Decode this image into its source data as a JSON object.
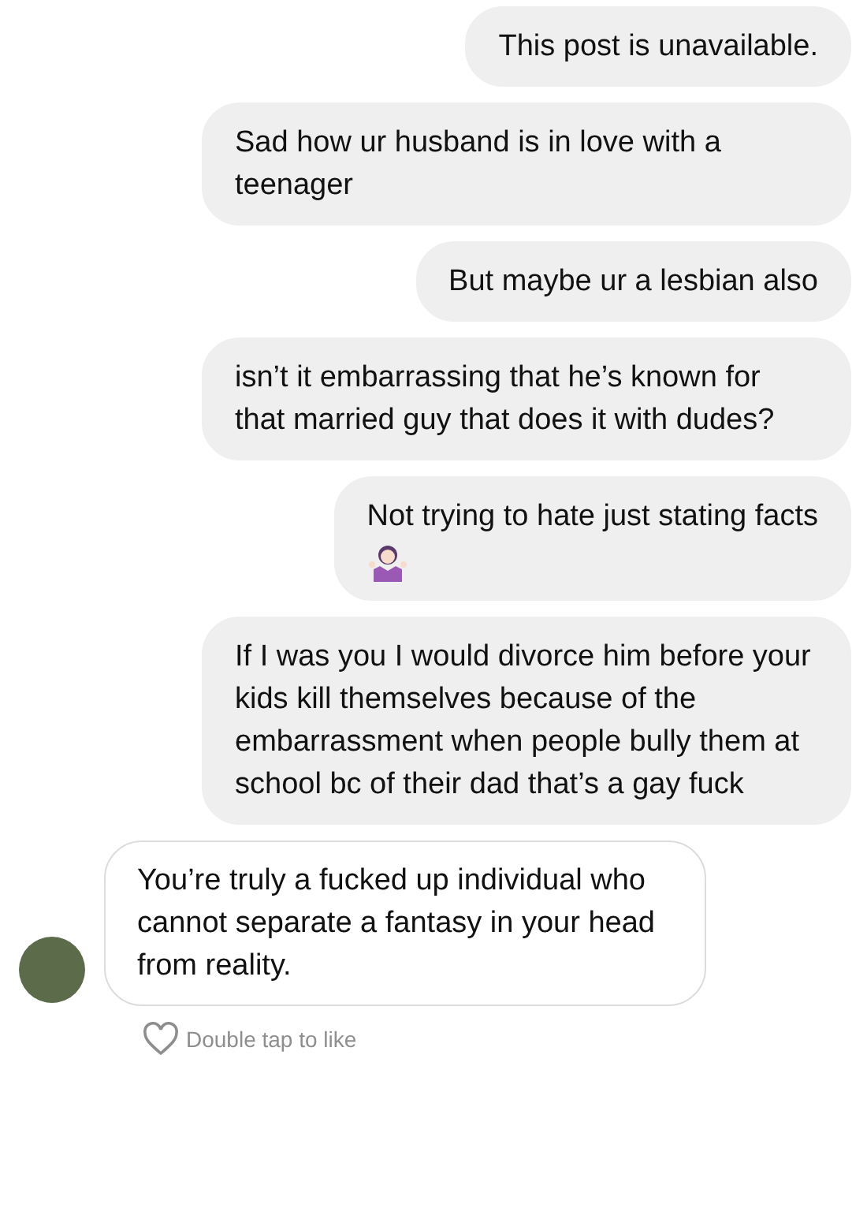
{
  "messages": [
    {
      "kind": "sent",
      "text": "This post is unavailable.",
      "has_emoji": false
    },
    {
      "kind": "sent",
      "text": "Sad how ur husband is in love with a teenager",
      "has_emoji": false
    },
    {
      "kind": "sent",
      "text": "But maybe ur a lesbian also",
      "has_emoji": false
    },
    {
      "kind": "sent",
      "text": "isn’t it embarrassing that he’s known for that married guy that does it with dudes?",
      "has_emoji": false
    },
    {
      "kind": "sent",
      "text": "Not trying to hate just stating facts",
      "has_emoji": true
    },
    {
      "kind": "sent",
      "text": "If I was you I would divorce him before your kids kill themselves because of the embarrassment when people bully them at school bc of their dad that’s a gay fuck",
      "has_emoji": false
    },
    {
      "kind": "received",
      "text": "You’re truly a fucked up individual who cannot separate a fantasy in your head from reality.",
      "has_emoji": false
    }
  ],
  "like_hint": "Double tap to like"
}
